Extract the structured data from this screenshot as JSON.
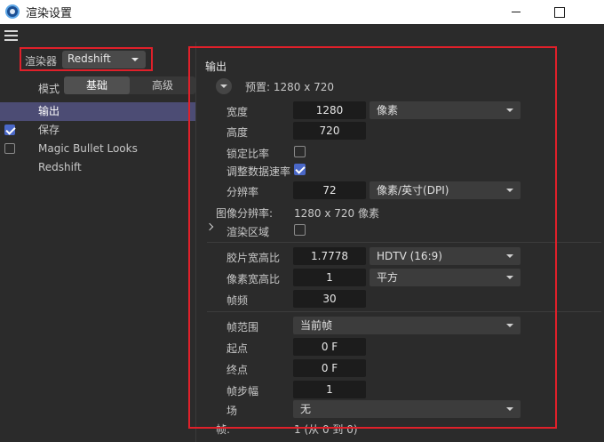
{
  "window": {
    "title": "渲染设置"
  },
  "left": {
    "renderer_label": "渲染器",
    "renderer_value": "Redshift",
    "mode_label": "模式",
    "mode_tabs": [
      "基础",
      "高级"
    ],
    "nav": [
      {
        "label": "输出",
        "selected": true,
        "checkbox": null
      },
      {
        "label": "保存",
        "selected": false,
        "checkbox": true
      },
      {
        "label": "Magic Bullet Looks",
        "selected": false,
        "checkbox": false
      },
      {
        "label": "Redshift",
        "selected": false,
        "checkbox": null
      }
    ]
  },
  "output": {
    "section_title": "输出",
    "preset": "预置: 1280 x 720",
    "width_label": "宽度",
    "width_value": "1280",
    "width_unit": "像素",
    "height_label": "高度",
    "height_value": "720",
    "lock_ratio_label": "锁定比率",
    "lock_ratio_checked": false,
    "adjust_rate_label": "调整数据速率",
    "adjust_rate_checked": true,
    "resolution_label": "分辨率",
    "resolution_value": "72",
    "resolution_unit": "像素/英寸(DPI)",
    "image_resolution_label": "图像分辨率:",
    "image_resolution_value": "1280 x 720 像素",
    "render_region_label": "渲染区域",
    "render_region_checked": false,
    "film_aspect_label": "胶片宽高比",
    "film_aspect_value": "1.7778",
    "film_aspect_preset": "HDTV (16:9)",
    "pixel_aspect_label": "像素宽高比",
    "pixel_aspect_value": "1",
    "pixel_aspect_preset": "平方",
    "frame_rate_label": "帧频",
    "frame_rate_value": "30",
    "frame_range_label": "帧范围",
    "frame_range_value": "当前帧",
    "start_label": "起点",
    "start_value": "0 F",
    "end_label": "终点",
    "end_value": "0 F",
    "frame_step_label": "帧步幅",
    "frame_step_value": "1",
    "field_label": "场",
    "field_value": "无",
    "frames_label": "帧:",
    "frames_value": "1 (从 0 到 0)"
  },
  "colors": {
    "background": "#2b2b2b",
    "selected_nav": "#4c4c74",
    "checkbox_accent": "#4a68c8",
    "highlight_box": "#e0202a"
  }
}
